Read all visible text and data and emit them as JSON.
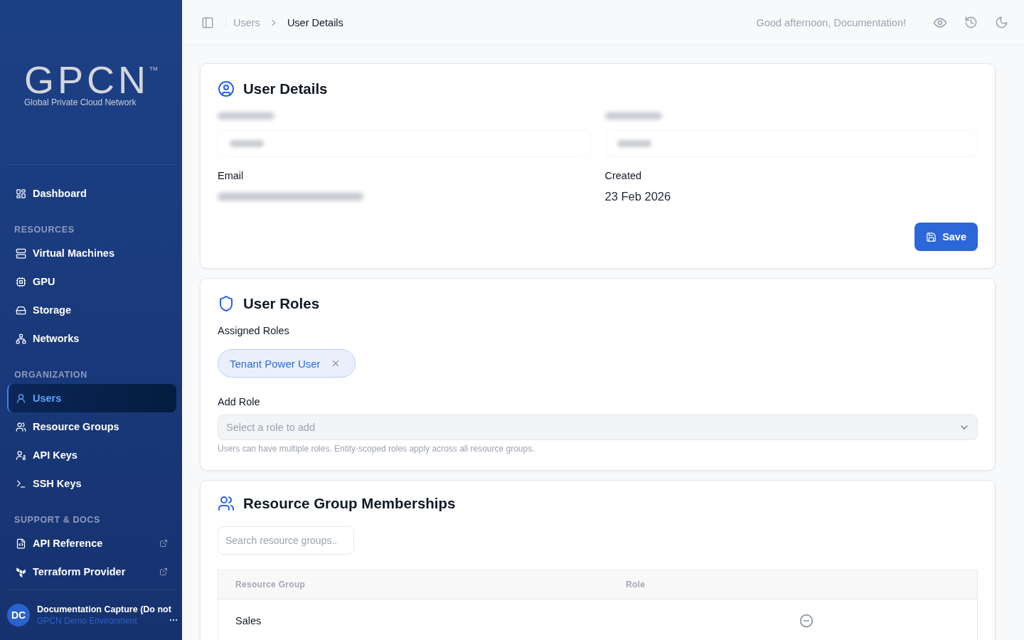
{
  "sidebar": {
    "logo": {
      "wordmark": "GPCN",
      "trademark": "TM",
      "tagline": "Global Private Cloud Network"
    },
    "sections": [
      {
        "items": [
          {
            "label": "Dashboard",
            "selected": false,
            "external": false
          }
        ]
      },
      {
        "heading": "RESOURCES",
        "items": [
          {
            "label": "Virtual Machines",
            "selected": false,
            "external": false
          },
          {
            "label": "GPU",
            "selected": false,
            "external": false
          },
          {
            "label": "Storage",
            "selected": false,
            "external": false
          },
          {
            "label": "Networks",
            "selected": false,
            "external": false
          }
        ]
      },
      {
        "heading": "ORGANIZATION",
        "items": [
          {
            "label": "Users",
            "selected": true,
            "external": false
          },
          {
            "label": "Resource Groups",
            "selected": false,
            "external": false
          },
          {
            "label": "API Keys",
            "selected": false,
            "external": false
          },
          {
            "label": "SSH Keys",
            "selected": false,
            "external": false
          }
        ]
      },
      {
        "heading": "SUPPORT & DOCS",
        "items": [
          {
            "label": "API Reference",
            "selected": false,
            "external": true
          },
          {
            "label": "Terraform Provider",
            "selected": false,
            "external": true
          }
        ]
      }
    ],
    "user": {
      "initials": "DC",
      "name": "Documentation Capture (Do not",
      "subtitle": "GPCN Demo Environment"
    }
  },
  "topbar": {
    "breadcrumbs": [
      {
        "label": "Users",
        "current": false
      },
      {
        "label": "User Details",
        "current": true
      }
    ],
    "greeting": "Good afternoon, Documentation!"
  },
  "user_details": {
    "title": "User Details",
    "name_fields": [
      {
        "blurred": true
      },
      {
        "blurred": true
      }
    ],
    "fields": [
      {
        "label": "Email",
        "blurred": true
      },
      {
        "label": "Created",
        "value": "23 Feb 2026",
        "blurred": false
      }
    ],
    "save_button": "Save"
  },
  "user_roles": {
    "title": "User Roles",
    "assigned_label": "Assigned Roles",
    "roles": [
      {
        "label": "Tenant Power User"
      }
    ],
    "add_label": "Add Role",
    "select": {
      "placeholder": "Select a role to add"
    },
    "hint": "Users can have multiple roles. Entity-scoped roles apply across all resource groups."
  },
  "memberships": {
    "title": "Resource Group Memberships",
    "search": {
      "placeholder": "Search resource groups.."
    },
    "table": {
      "columns": [
        "Resource Group",
        "Role"
      ],
      "rows": [
        {
          "resource_group": "Sales"
        }
      ]
    }
  }
}
